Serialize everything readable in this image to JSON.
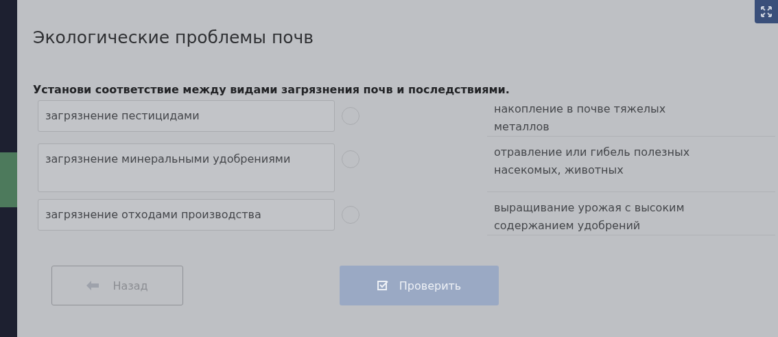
{
  "title": "Экологические проблемы почв",
  "question": "Установи соответствие между видами загрязнения почв и последствиями.",
  "left_items": [
    {
      "text": "загрязнение пестицидами"
    },
    {
      "text": "загрязнение минеральными удобрениями"
    },
    {
      "text": "загрязнение отходами производства"
    }
  ],
  "right_items": [
    {
      "text": "накопление в почве тяжелых металлов"
    },
    {
      "text": "отравление или гибель полезных насекомых, животных"
    },
    {
      "text": "выращивание урожая с высоким содержанием удобрений"
    }
  ],
  "back_button": {
    "label": "Назад"
  },
  "check_button": {
    "label": "Проверить",
    "disabled": true
  }
}
